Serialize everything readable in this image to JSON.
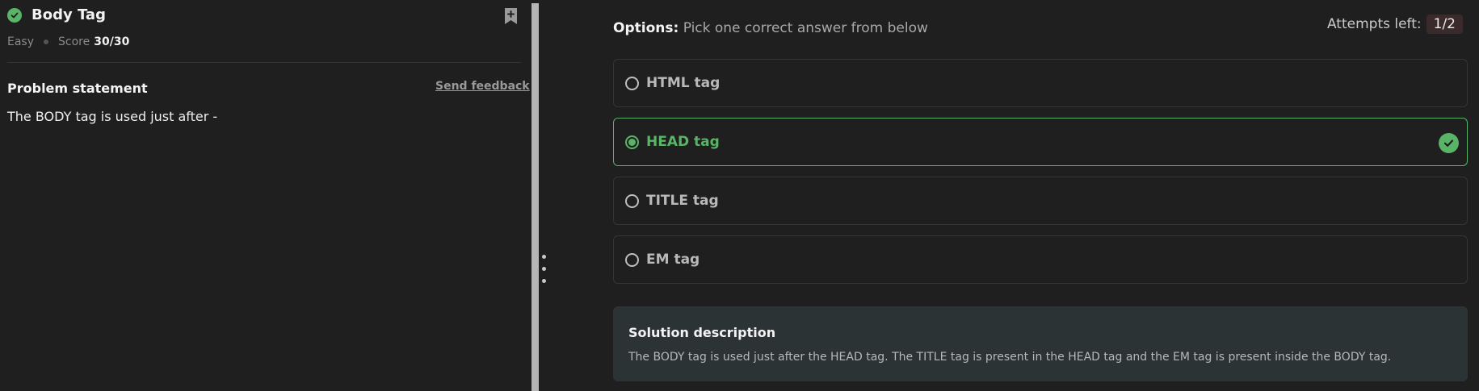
{
  "problem": {
    "title": "Body Tag",
    "difficulty": "Easy",
    "score_label": "Score",
    "score_value": "30/30",
    "statement_title": "Problem statement",
    "feedback_label": "Send feedback",
    "statement_text": "The BODY tag is used just after -"
  },
  "options_panel": {
    "heading_label": "Options:",
    "heading_hint": "Pick one correct answer from below",
    "attempts_label": "Attempts left:",
    "attempts_value": "1/2",
    "options": [
      {
        "label": "HTML tag",
        "selected": false
      },
      {
        "label": "HEAD tag",
        "selected": true
      },
      {
        "label": "TITLE tag",
        "selected": false
      },
      {
        "label": "EM tag",
        "selected": false
      }
    ]
  },
  "solution": {
    "title": "Solution description",
    "text": "The BODY tag is used just after the HEAD tag. The TITLE tag is present in the HEAD tag and the EM tag is present inside the BODY tag."
  },
  "colors": {
    "success": "#59b467",
    "background": "#1f1f1f",
    "solution_bg": "#2c3335",
    "attempts_pill": "#3b2a2c"
  },
  "icons": {
    "solved": "check-circle-icon",
    "bookmark": "bookmark-plus-icon",
    "correct": "check-circle-icon",
    "splitter": "drag-handle-icon"
  }
}
